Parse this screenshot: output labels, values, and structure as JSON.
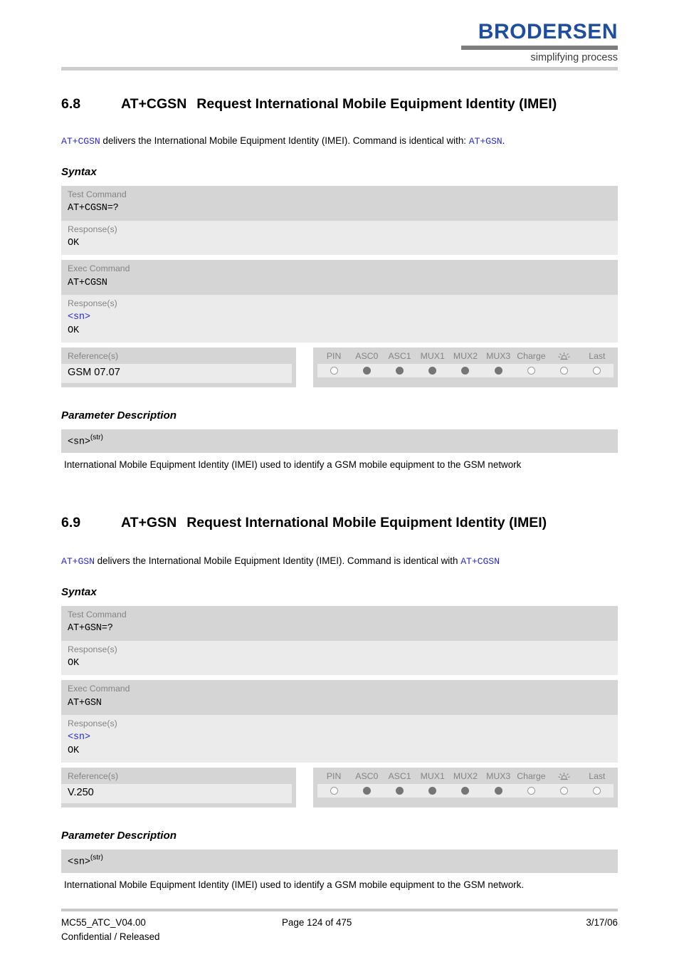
{
  "header": {
    "logo_word": "BRODERSEN",
    "logo_tagline": "simplifying process"
  },
  "sections": [
    {
      "number": "6.8",
      "command": "AT+CGSN",
      "title": "Request International Mobile Equipment Identity (IMEI)",
      "intro_cmd": "AT+CGSN",
      "intro_text": " delivers the International Mobile Equipment Identity (IMEI). Command is identical with: ",
      "intro_cmd2": "AT+GSN",
      "intro_tail": ".",
      "syntax_label": "Syntax",
      "rows": [
        {
          "label": "Test Command",
          "value": "AT+CGSN=?",
          "shade": "dark"
        },
        {
          "label": "Response(s)",
          "value": "OK",
          "shade": "light"
        },
        {
          "label": "Exec Command",
          "value": "AT+CGSN",
          "shade": "dark"
        },
        {
          "label": "Response(s)",
          "value_blue": "<sn>",
          "value": "OK",
          "shade": "light"
        }
      ],
      "reference_label": "Reference(s)",
      "reference_value": "GSM 07.07",
      "indicators": {
        "headers": [
          "PIN",
          "ASC0",
          "ASC1",
          "MUX1",
          "MUX2",
          "MUX3",
          "Charge",
          "alarm-icon",
          "Last"
        ],
        "states": [
          "empty",
          "filled",
          "filled",
          "filled",
          "filled",
          "filled",
          "empty",
          "empty",
          "empty"
        ]
      },
      "param_label": "Parameter Description",
      "param_name": "<sn>",
      "param_sup": "(str)",
      "param_desc": "International Mobile Equipment Identity (IMEI) used to identify a GSM mobile equipment to the GSM network"
    },
    {
      "number": "6.9",
      "command": "AT+GSN",
      "title": "Request International Mobile Equipment Identity (IMEI)",
      "intro_cmd": "AT+GSN",
      "intro_text": " delivers the International Mobile Equipment Identity (IMEI). Command is identical with ",
      "intro_cmd2": "AT+CGSN",
      "intro_tail": "",
      "syntax_label": "Syntax",
      "rows": [
        {
          "label": "Test Command",
          "value": "AT+GSN=?",
          "shade": "dark"
        },
        {
          "label": "Response(s)",
          "value": "OK",
          "shade": "light"
        },
        {
          "label": "Exec Command",
          "value": "AT+GSN",
          "shade": "dark"
        },
        {
          "label": "Response(s)",
          "value_blue": "<sn>",
          "value": "OK",
          "shade": "light"
        }
      ],
      "reference_label": "Reference(s)",
      "reference_value": "V.250",
      "indicators": {
        "headers": [
          "PIN",
          "ASC0",
          "ASC1",
          "MUX1",
          "MUX2",
          "MUX3",
          "Charge",
          "alarm-icon",
          "Last"
        ],
        "states": [
          "empty",
          "filled",
          "filled",
          "filled",
          "filled",
          "filled",
          "empty",
          "empty",
          "empty"
        ]
      },
      "param_label": "Parameter Description",
      "param_name": "<sn>",
      "param_sup": "(str)",
      "param_desc": "International Mobile Equipment Identity (IMEI) used to identify a GSM mobile equipment to the GSM network."
    }
  ],
  "footer": {
    "doc_id": "MC55_ATC_V04.00",
    "classification": "Confidential / Released",
    "page": "Page 124 of 475",
    "date": "3/17/06"
  },
  "colors": {
    "logo_blue": "#1f4e9c",
    "command_blue": "#2a2ad4",
    "row_dark": "#d5d5d5",
    "row_light": "#ebebeb",
    "label_gray": "#848484"
  }
}
